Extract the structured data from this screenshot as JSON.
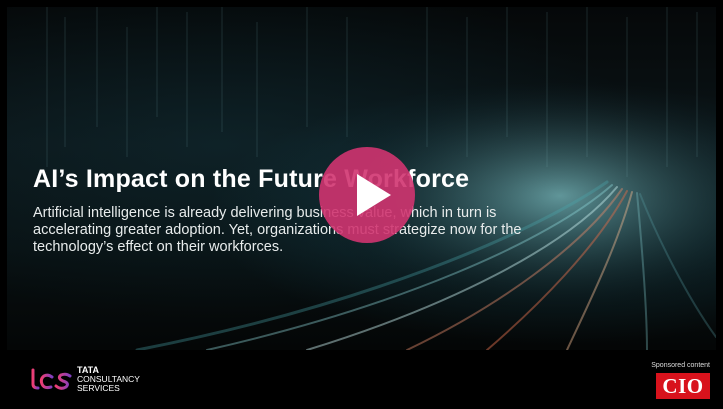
{
  "video": {
    "title": "AI’s Impact on the Future Workforce",
    "description": "Artificial intelligence is already delivering business value, which in turn is accelerating greater adoption. Yet, organizations must strategize now for the technology’s effect on their workforces.",
    "play_icon": "play-icon",
    "accent_color": "#d03470"
  },
  "footer": {
    "logo_mark": "tcs",
    "company_line1": "TATA",
    "company_line2": "CONSULTANCY",
    "company_line3": "SERVICES",
    "sponsored_label": "Sponsored content",
    "sponsor_logo": "CIO",
    "logo_gradient": [
      "#ef3e72",
      "#7f3fbf"
    ],
    "cio_color": "#d8121c"
  }
}
